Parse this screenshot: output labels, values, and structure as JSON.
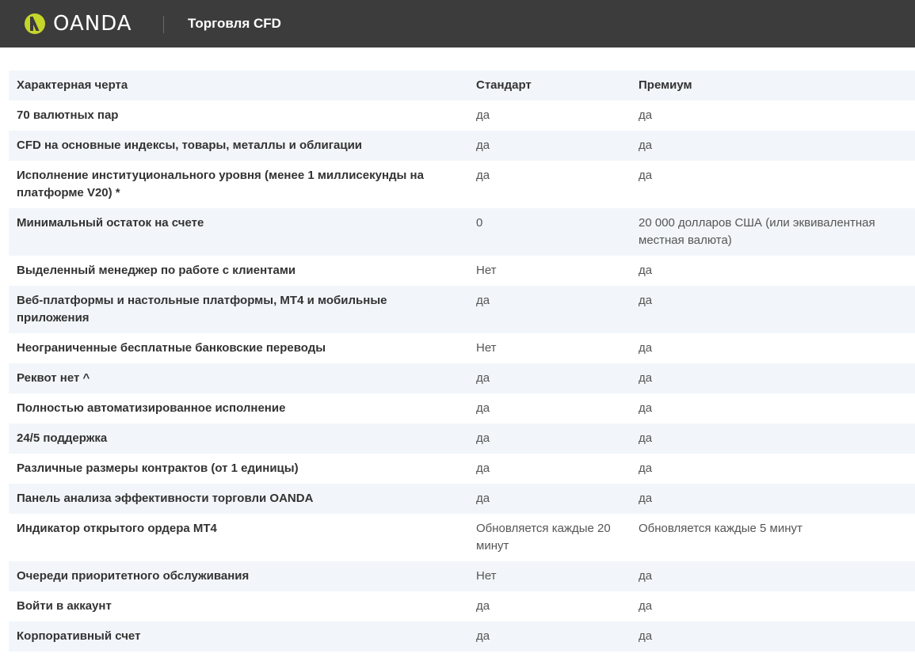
{
  "header": {
    "logo_text": "OANDA",
    "title": "Торговля CFD"
  },
  "table": {
    "columns": [
      "Характерная черта",
      "Стандарт",
      "Премиум"
    ],
    "rows": [
      [
        "70 валютных пар",
        "да",
        "да"
      ],
      [
        "CFD на основные индексы, товары, металлы и облигации",
        "да",
        "да"
      ],
      [
        "Исполнение институционального уровня (менее 1 миллисекунды на платформе V20) *",
        "да",
        "да"
      ],
      [
        "Минимальный остаток на счете",
        "0",
        "20 000 долларов США (или эквивалентная местная валюта)"
      ],
      [
        "Выделенный менеджер по работе с клиентами",
        "Нет",
        "да"
      ],
      [
        "Веб-платформы и настольные платформы, MT4 и мобильные приложения",
        "да",
        "да"
      ],
      [
        "Неограниченные бесплатные банковские переводы",
        "Нет",
        "да"
      ],
      [
        "Реквот нет ^",
        "да",
        "да"
      ],
      [
        "Полностью автоматизированное исполнение",
        "да",
        "да"
      ],
      [
        "24/5 поддержка",
        "да",
        "да"
      ],
      [
        "Различные размеры контрактов (от 1 единицы)",
        "да",
        "да"
      ],
      [
        "Панель анализа эффективности торговли OANDA",
        "да",
        "да"
      ],
      [
        "Индикатор открытого ордера MT4",
        "Обновляется каждые 20 минут",
        "Обновляется каждые 5 минут"
      ],
      [
        "Очереди приоритетного обслуживания",
        "Нет",
        "да"
      ],
      [
        "Войти в аккаунт",
        "да",
        "да"
      ],
      [
        "Корпоративный счет",
        "да",
        "да"
      ]
    ]
  }
}
